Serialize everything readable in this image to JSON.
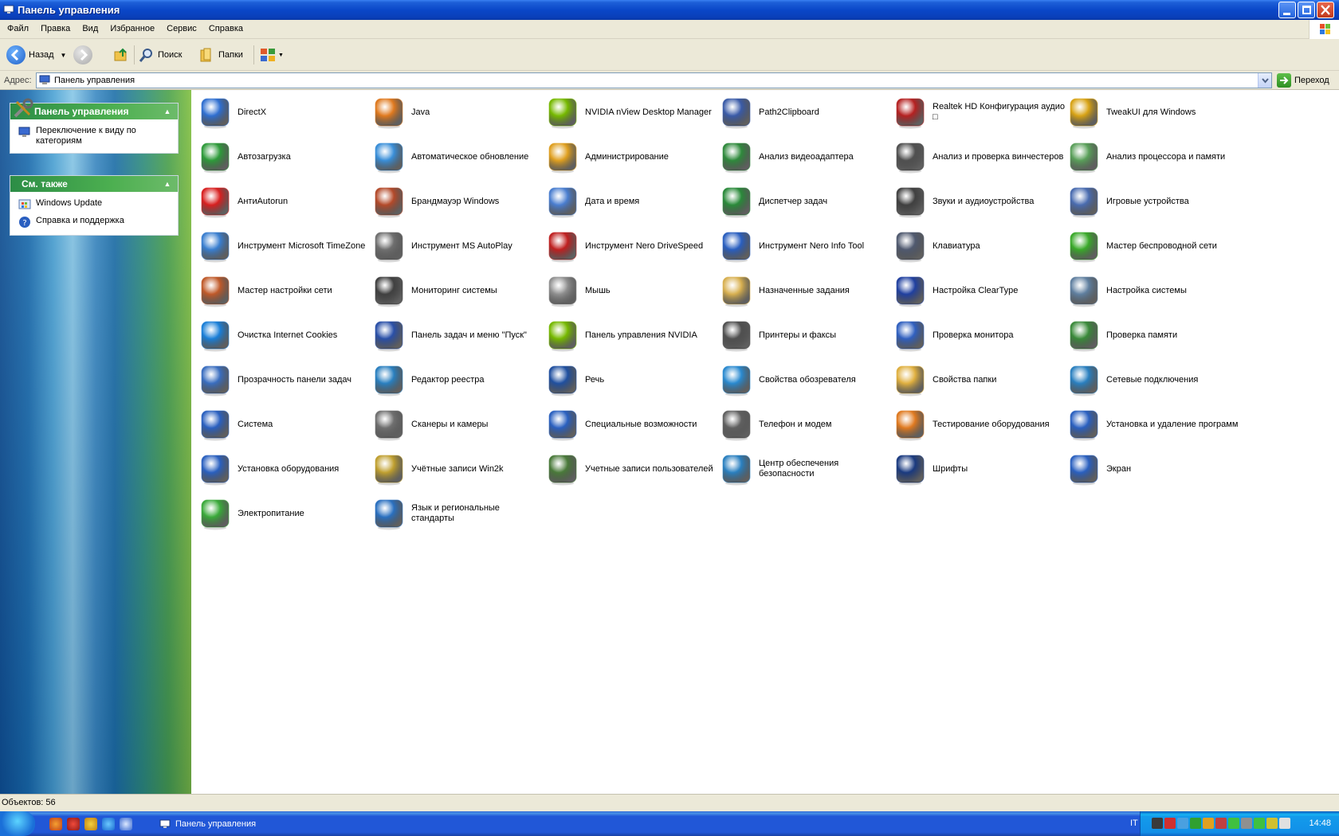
{
  "window": {
    "title": "Панель управления"
  },
  "menu": [
    "Файл",
    "Правка",
    "Вид",
    "Избранное",
    "Сервис",
    "Справка"
  ],
  "toolbar": {
    "back_label": "Назад",
    "search_label": "Поиск",
    "folders_label": "Папки"
  },
  "address": {
    "label": "Адрес:",
    "value": "Панель управления",
    "go_label": "Переход"
  },
  "taskpane": {
    "panel_title": "Панель управления",
    "switch_view": "Переключение к виду по категориям",
    "see_also_title": "См. также",
    "see_also": [
      "Windows Update",
      "Справка и поддержка"
    ]
  },
  "items": [
    {
      "label": "DirectX",
      "icon": "directx-icon",
      "color": "#2f6fd1"
    },
    {
      "label": "Java",
      "icon": "java-icon",
      "color": "#e07a1f"
    },
    {
      "label": "NVIDIA nView Desktop Manager",
      "icon": "nvidia-icon",
      "color": "#76b900"
    },
    {
      "label": "Path2Clipboard",
      "icon": "computer-icon",
      "color": "#3a5ba8"
    },
    {
      "label": "Realtek HD Конфигурация аудио □",
      "icon": "speaker-icon",
      "color": "#b52121"
    },
    {
      "label": "TweakUI для Windows",
      "icon": "tools-icon",
      "color": "#d8a315"
    },
    {
      "label": "Автозагрузка",
      "icon": "autorun-icon",
      "color": "#2e9b3a"
    },
    {
      "label": "Автоматическое обновление",
      "icon": "update-icon",
      "color": "#3a8fd9"
    },
    {
      "label": "Администрирование",
      "icon": "admin-tools-icon",
      "color": "#e0a020"
    },
    {
      "label": "Анализ видеоадаптера",
      "icon": "video-card-icon",
      "color": "#2f8a3c"
    },
    {
      "label": "Анализ и проверка винчестеров",
      "icon": "harddisk-icon",
      "color": "#505050"
    },
    {
      "label": "Анализ процессора и памяти",
      "icon": "cpu-icon",
      "color": "#5aa05a"
    },
    {
      "label": "АнтиAutorun",
      "icon": "first-aid-icon",
      "color": "#d82020"
    },
    {
      "label": "Брандмауэр Windows",
      "icon": "firewall-icon",
      "color": "#b44a2a"
    },
    {
      "label": "Дата и время",
      "icon": "clock-icon",
      "color": "#4a7ed0"
    },
    {
      "label": "Диспетчер задач",
      "icon": "monitor-icon",
      "color": "#2a8a3a"
    },
    {
      "label": "Звуки и аудиоустройства",
      "icon": "speakers-icon",
      "color": "#404040"
    },
    {
      "label": "Игровые устройства",
      "icon": "gamepad-icon",
      "color": "#4a6cb0"
    },
    {
      "label": "Инструмент Microsoft TimeZone",
      "icon": "globe-clock-icon",
      "color": "#3a7fd0"
    },
    {
      "label": "Инструмент MS AutoPlay",
      "icon": "cd-drive-icon",
      "color": "#707070"
    },
    {
      "label": "Инструмент Nero DriveSpeed",
      "icon": "nero-drive-icon",
      "color": "#c02020"
    },
    {
      "label": "Инструмент Nero Info Tool",
      "icon": "nero-info-icon",
      "color": "#2a5fc0"
    },
    {
      "label": "Клавиатура",
      "icon": "keyboard-icon",
      "color": "#505a70"
    },
    {
      "label": "Мастер беспроводной сети",
      "icon": "wireless-icon",
      "color": "#3aaa2a"
    },
    {
      "label": "Мастер настройки сети",
      "icon": "home-network-icon",
      "color": "#c05a2a"
    },
    {
      "label": "Мониторинг системы",
      "icon": "gauge-icon",
      "color": "#404040"
    },
    {
      "label": "Мышь",
      "icon": "mouse-icon",
      "color": "#909090"
    },
    {
      "label": "Назначенные задания",
      "icon": "scheduled-tasks-icon",
      "color": "#d8b050"
    },
    {
      "label": "Настройка ClearType",
      "icon": "cleartype-icon",
      "color": "#2040a0"
    },
    {
      "label": "Настройка системы",
      "icon": "system-tools-icon",
      "color": "#6080a0"
    },
    {
      "label": "Очистка Internet Cookies",
      "icon": "ie-icon",
      "color": "#1a7fd8"
    },
    {
      "label": "Панель задач и меню \"Пуск\"",
      "icon": "taskbar-icon",
      "color": "#2a50a8"
    },
    {
      "label": "Панель управления NVIDIA",
      "icon": "nvidia-panel-icon",
      "color": "#76b900"
    },
    {
      "label": "Принтеры и факсы",
      "icon": "printer-icon",
      "color": "#505050"
    },
    {
      "label": "Проверка монитора",
      "icon": "monitor-test-icon",
      "color": "#3060c0"
    },
    {
      "label": "Проверка памяти",
      "icon": "memory-icon",
      "color": "#3a8a3a"
    },
    {
      "label": "Прозрачность панели задач",
      "icon": "transparency-icon",
      "color": "#3a6ec0"
    },
    {
      "label": "Редактор реестра",
      "icon": "registry-icon",
      "color": "#2a80c0"
    },
    {
      "label": "Речь",
      "icon": "speech-icon",
      "color": "#2050a0"
    },
    {
      "label": "Свойства обозревателя",
      "icon": "internet-options-icon",
      "color": "#2a8ad0"
    },
    {
      "label": "Свойства папки",
      "icon": "folder-options-icon",
      "color": "#e0b040"
    },
    {
      "label": "Сетевые подключения",
      "icon": "network-icon",
      "color": "#2a80c0"
    },
    {
      "label": "Система",
      "icon": "system-icon",
      "color": "#2a60c0"
    },
    {
      "label": "Сканеры и камеры",
      "icon": "scanner-icon",
      "color": "#707070"
    },
    {
      "label": "Специальные возможности",
      "icon": "accessibility-icon",
      "color": "#2a60c0"
    },
    {
      "label": "Телефон и модем",
      "icon": "phone-icon",
      "color": "#606060"
    },
    {
      "label": "Тестирование оборудования",
      "icon": "benchmark-icon",
      "color": "#e07a20"
    },
    {
      "label": "Установка и удаление программ",
      "icon": "add-remove-icon",
      "color": "#2a60c0"
    },
    {
      "label": "Установка оборудования",
      "icon": "hardware-icon",
      "color": "#2a60c0"
    },
    {
      "label": "Учётные записи Win2k",
      "icon": "lock-users-icon",
      "color": "#c0a030"
    },
    {
      "label": "Учетные записи пользователей",
      "icon": "user-accounts-icon",
      "color": "#4a7a3a"
    },
    {
      "label": "Центр обеспечения безопасности",
      "icon": "security-center-icon",
      "color": "#2a80c0"
    },
    {
      "label": "Шрифты",
      "icon": "fonts-icon",
      "color": "#1a3a80"
    },
    {
      "label": "Экран",
      "icon": "display-icon",
      "color": "#2a60c0"
    },
    {
      "label": "Электропитание",
      "icon": "power-icon",
      "color": "#3aaa3a"
    },
    {
      "label": "Язык и региональные стандарты",
      "icon": "globe-icon",
      "color": "#2a70c0"
    }
  ],
  "status": {
    "text": "Объектов: 56"
  },
  "taskbar": {
    "window_label": "Панель управления",
    "lang": "IT",
    "clock": "14:48"
  }
}
